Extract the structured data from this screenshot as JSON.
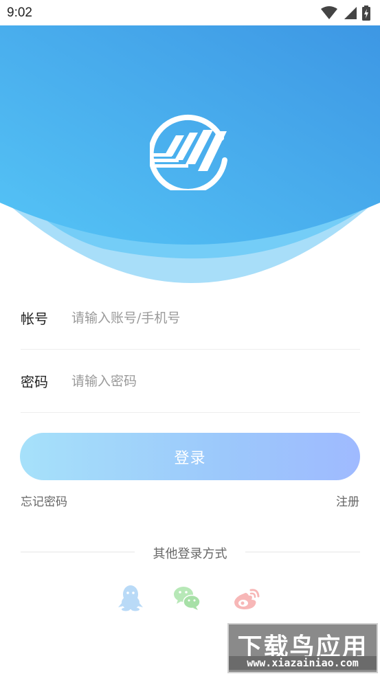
{
  "status_bar": {
    "time": "9:02",
    "icons": [
      "wifi-icon",
      "signal-icon",
      "battery-charging-icon"
    ]
  },
  "header": {
    "logo": "brand-logo"
  },
  "form": {
    "account": {
      "label": "帐号",
      "placeholder": "请输入账号/手机号"
    },
    "password": {
      "label": "密码",
      "placeholder": "请输入密码"
    },
    "login_label": "登录",
    "forgot_label": "忘记密码",
    "register_label": "注册"
  },
  "other_login": {
    "title": "其他登录方式",
    "methods": [
      "qq-icon",
      "wechat-icon",
      "weibo-icon"
    ]
  },
  "watermark": {
    "top": "下载鸟应用",
    "bottom": "www.xiazainiao.com"
  },
  "colors": {
    "header_blue": "#4bb2ee",
    "qq": "#b9daf7",
    "wechat": "#b7e8b7",
    "weibo": "#f7b7b7"
  }
}
